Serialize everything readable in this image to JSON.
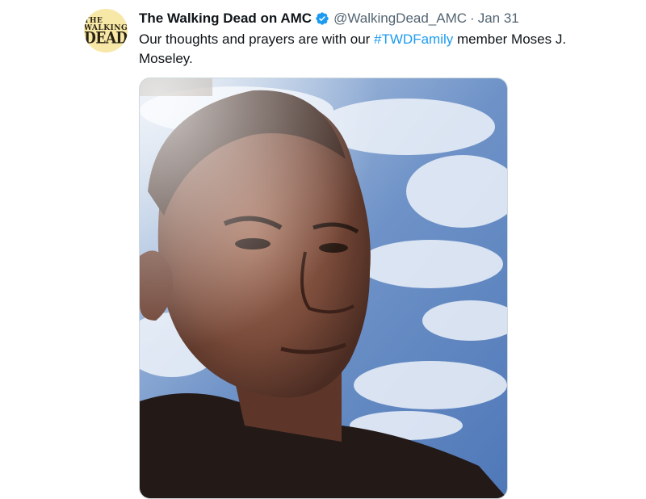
{
  "tweet": {
    "display_name": "The Walking Dead on AMC",
    "handle": "@WalkingDead_AMC",
    "separator": "·",
    "date": "Jan 31",
    "text_before": "Our thoughts and prayers are with our ",
    "hashtag": "#TWDFamily",
    "text_after": " member Moses J. Moseley.",
    "verified_icon": "verified-badge-icon",
    "hashtag_color": "#1d9bf0"
  },
  "avatar": {
    "logo_line1": "THE WALKING",
    "logo_line2": "DEAD"
  }
}
